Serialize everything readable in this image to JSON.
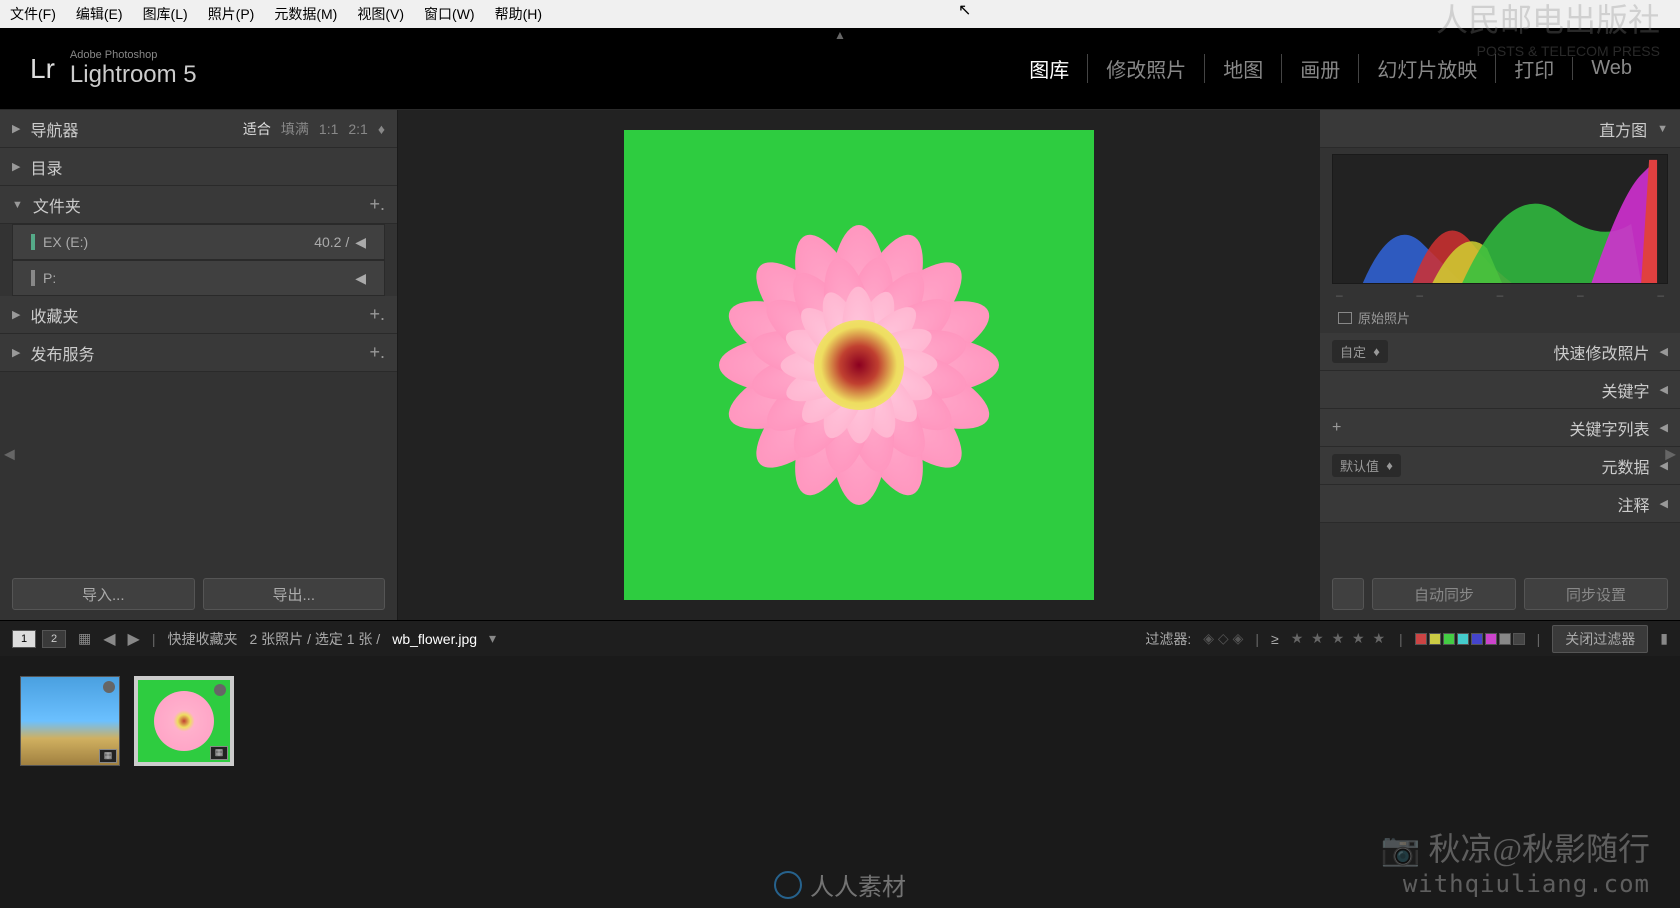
{
  "menubar": [
    "文件(F)",
    "编辑(E)",
    "图库(L)",
    "照片(P)",
    "元数据(M)",
    "视图(V)",
    "窗口(W)",
    "帮助(H)"
  ],
  "logo": {
    "lr": "Lr",
    "small": "Adobe Photoshop",
    "big": "Lightroom 5"
  },
  "modules": [
    {
      "label": "图库",
      "active": true
    },
    {
      "label": "修改照片",
      "active": false
    },
    {
      "label": "地图",
      "active": false
    },
    {
      "label": "画册",
      "active": false
    },
    {
      "label": "幻灯片放映",
      "active": false
    },
    {
      "label": "打印",
      "active": false
    },
    {
      "label": "Web",
      "active": false
    }
  ],
  "leftpanels": {
    "navigator": {
      "label": "导航器",
      "fit": "适合",
      "fill": "填满",
      "one": "1:1",
      "two": "2:1"
    },
    "catalog": "目录",
    "folders": {
      "label": "文件夹",
      "drives": [
        {
          "name": "EX (E:)",
          "size": "40.2 /",
          "on": true
        },
        {
          "name": "P:",
          "size": "",
          "on": false
        }
      ]
    },
    "collections": "收藏夹",
    "publish": "发布服务",
    "import": "导入...",
    "export": "导出..."
  },
  "rightpanels": {
    "histogram": "直方图",
    "original": "原始照片",
    "quickdev": {
      "dropdown": "自定",
      "label": "快速修改照片"
    },
    "keyword": "关键字",
    "keywordlist": "关键字列表",
    "metadata": {
      "dropdown": "默认值",
      "label": "元数据"
    },
    "comment": "注释",
    "autosync": "自动同步",
    "syncset": "同步设置"
  },
  "filterbar": {
    "view1": "1",
    "view2": "2",
    "quick": "快捷收藏夹",
    "count": "2 张照片 / 选定 1 张 /",
    "file": "wb_flower.jpg",
    "filter_label": "过滤器:",
    "ge": "≥",
    "off": "关闭过滤器"
  },
  "swatch_colors": [
    "#c44",
    "#cc4",
    "#4c4",
    "#4cc",
    "#44c",
    "#c4c",
    "#888",
    "#444"
  ],
  "watermarks": {
    "press_cn": "人民邮电出版社",
    "press_en": "POSTS & TELECOM PRESS",
    "bottom1": "📷 秋凉@秋影随行",
    "bottom2": "withqiuliang.com",
    "center": "人人素材"
  }
}
